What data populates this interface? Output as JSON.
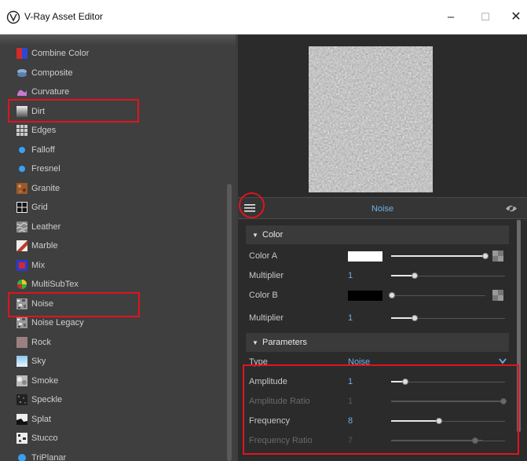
{
  "window": {
    "title": "V-Ray Asset Editor"
  },
  "texture_list": [
    {
      "label": "Combine Color",
      "icon": "combine-color-icon"
    },
    {
      "label": "Composite",
      "icon": "composite-icon"
    },
    {
      "label": "Curvature",
      "icon": "curvature-icon"
    },
    {
      "label": "Dirt",
      "icon": "dirt-icon"
    },
    {
      "label": "Edges",
      "icon": "edges-icon"
    },
    {
      "label": "Falloff",
      "icon": "falloff-icon"
    },
    {
      "label": "Fresnel",
      "icon": "fresnel-icon"
    },
    {
      "label": "Granite",
      "icon": "granite-icon"
    },
    {
      "label": "Grid",
      "icon": "grid-icon"
    },
    {
      "label": "Leather",
      "icon": "leather-icon"
    },
    {
      "label": "Marble",
      "icon": "marble-icon"
    },
    {
      "label": "Mix",
      "icon": "mix-icon"
    },
    {
      "label": "MultiSubTex",
      "icon": "multisubtex-icon"
    },
    {
      "label": "Noise",
      "icon": "noise-icon"
    },
    {
      "label": "Noise Legacy",
      "icon": "noise-legacy-icon"
    },
    {
      "label": "Rock",
      "icon": "rock-icon"
    },
    {
      "label": "Sky",
      "icon": "sky-icon"
    },
    {
      "label": "Smoke",
      "icon": "smoke-icon"
    },
    {
      "label": "Speckle",
      "icon": "speckle-icon"
    },
    {
      "label": "Splat",
      "icon": "splat-icon"
    },
    {
      "label": "Stucco",
      "icon": "stucco-icon"
    },
    {
      "label": "TriPlanar",
      "icon": "triplanar-icon"
    }
  ],
  "node": {
    "name": "Noise"
  },
  "color_section": {
    "title": "Color",
    "color_a": {
      "label": "Color A",
      "swatch": "#ffffff",
      "level": 1.0
    },
    "multiplier_a": {
      "label": "Multiplier",
      "value": "1",
      "level": 0.2
    },
    "color_b": {
      "label": "Color B",
      "swatch": "#000000",
      "level": 0.0
    },
    "multiplier_b": {
      "label": "Multiplier",
      "value": "1",
      "level": 0.2
    }
  },
  "parameters_section": {
    "title": "Parameters",
    "type": {
      "label": "Type",
      "value": "Noise"
    },
    "amplitude": {
      "label": "Amplitude",
      "value": "1",
      "level": 0.12
    },
    "amplitude_ratio": {
      "label": "Amplitude Ratio",
      "value": "1",
      "level": 1.0
    },
    "frequency": {
      "label": "Frequency",
      "value": "8",
      "level": 0.42
    },
    "frequency_ratio": {
      "label": "Frequency Ratio",
      "value": "7",
      "level": 0.8
    }
  },
  "colors": {
    "accent_blue": "#6fb0e8",
    "highlight_red": "#e0141e",
    "panel_dark": "#2b2b2b",
    "list_bg": "#3f3f3f"
  }
}
